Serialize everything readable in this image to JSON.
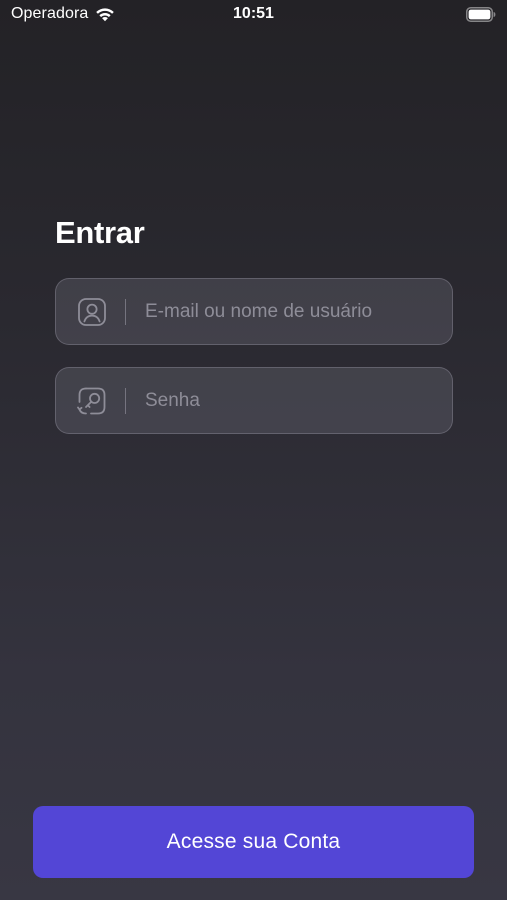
{
  "status_bar": {
    "carrier": "Operadora",
    "time": "10:51",
    "icons": [
      "wifi-icon",
      "battery-icon"
    ]
  },
  "login": {
    "title": "Entrar",
    "email_field": {
      "icon": "user-icon",
      "value": "",
      "placeholder": "E-mail ou nome de usuário"
    },
    "password_field": {
      "icon": "key-icon",
      "value": "",
      "placeholder": "Senha"
    },
    "submit_label": "Acesse sua Conta"
  },
  "colors": {
    "background_top": "#232226",
    "background_bottom": "#383743",
    "field_background": "#4a4954",
    "accent": "#5346d6",
    "placeholder": "#8e8d98",
    "text": "#ffffff"
  }
}
